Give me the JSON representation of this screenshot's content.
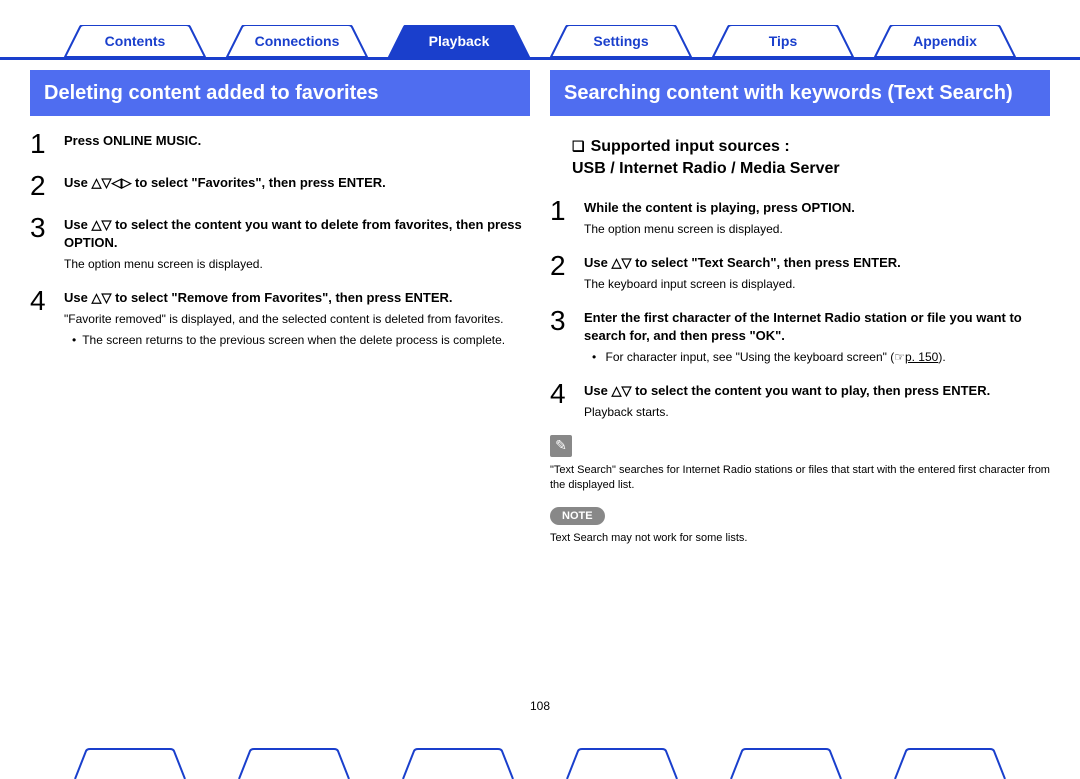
{
  "tabs": {
    "contents": "Contents",
    "connections": "Connections",
    "playback": "Playback",
    "settings": "Settings",
    "tips": "Tips",
    "appendix": "Appendix"
  },
  "left": {
    "title": "Deleting content added to favorites",
    "step1": "Press ONLINE MUSIC.",
    "step2": "Use △▽◁▷ to select \"Favorites\", then press ENTER.",
    "step3": "Use △▽ to select the content you want to delete from favorites, then press OPTION.",
    "step3_sub": "The option menu screen is displayed.",
    "step4": "Use △▽ to select \"Remove from Favorites\", then press ENTER.",
    "step4_sub": "\"Favorite removed\" is displayed, and the selected content is deleted from favorites.",
    "step4_bullet": "The screen returns to the previous screen when the delete process is complete."
  },
  "right": {
    "title": "Searching content with keywords (Text Search)",
    "sub_label": "Supported input sources :",
    "sub_value": "USB / Internet Radio / Media Server",
    "step1": "While the content is playing, press OPTION.",
    "step1_sub": "The option menu screen is displayed.",
    "step2": "Use △▽ to select \"Text Search\", then press ENTER.",
    "step2_sub": "The keyboard input screen is displayed.",
    "step3": "Enter the first character of the Internet Radio station or file you want to search for, and then press \"OK\".",
    "step3_bullet_pre": "For character input, see \"Using the keyboard screen\" (☞",
    "step3_link": "p. 150",
    "step3_bullet_post": ").",
    "step4": "Use △▽ to select the content you want to play, then press ENTER.",
    "step4_sub": "Playback starts.",
    "tip": "\"Text Search\" searches for Internet Radio stations or files that start with the entered first character from the displayed list.",
    "note_label": "NOTE",
    "note_text": "Text Search may not work for some lists."
  },
  "page_number": "108"
}
